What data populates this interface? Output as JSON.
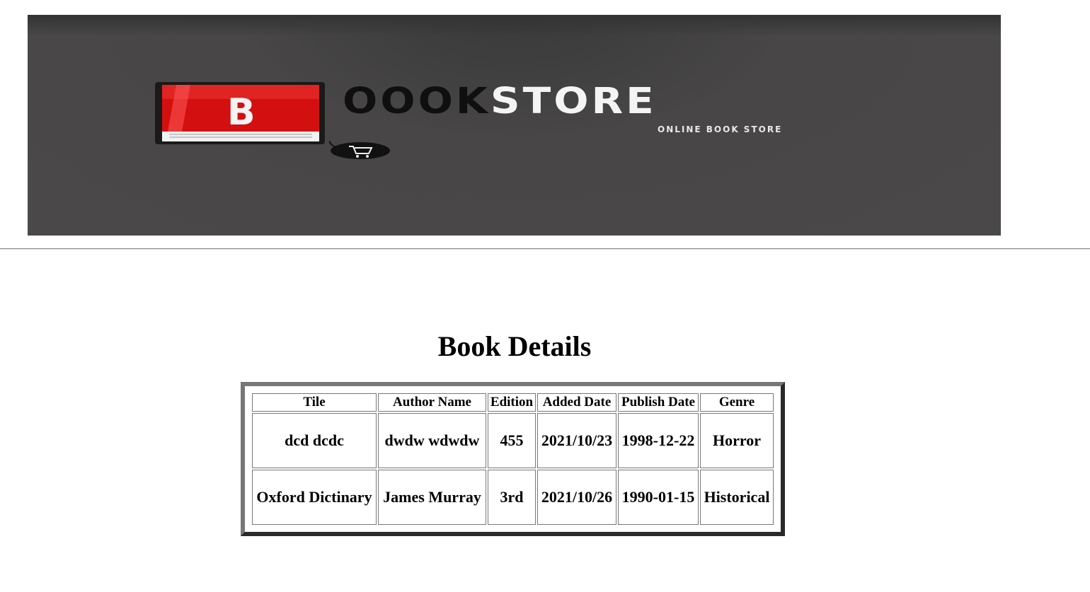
{
  "header": {
    "logo": {
      "letter": "B",
      "word_dark": "OOOK",
      "word_light": "STORE",
      "tagline": "ONLINE BOOK STORE"
    }
  },
  "main": {
    "title": "Book Details",
    "table": {
      "columns": [
        "Tile",
        "Author Name",
        "Edition",
        "Added Date",
        "Publish Date",
        "Genre"
      ],
      "rows": [
        [
          "dcd dcdc",
          "dwdw wdwdw",
          "455",
          "2021/10/23",
          "1998-12-22",
          "Horror"
        ],
        [
          "Oxford Dictinary",
          "James Murray",
          "3rd",
          "2021/10/26",
          "1990-01-15",
          "Historical"
        ]
      ]
    }
  },
  "colors": {
    "banner_bg": "#4a4848",
    "logo_red": "#d40f0f",
    "table_border": "#777777"
  }
}
